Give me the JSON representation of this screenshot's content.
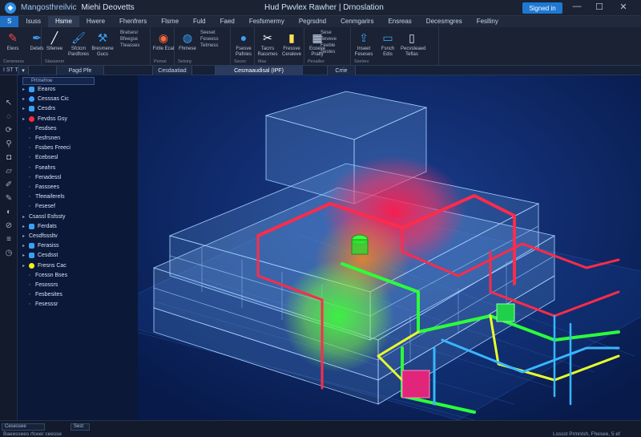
{
  "titlebar": {
    "app_icon": "app-logo-icon",
    "app_name": "Mangosthreilvic",
    "file_name": "Miehi Deovetts",
    "doc_title": "Hud Pwvlex Rawher | Drnoslation",
    "signin_label": "Signed in",
    "minimize": "—",
    "maximize": "☐",
    "close": "✕"
  },
  "menu_tabs": [
    "Isuss",
    "Hsme",
    "Hwere",
    "Fhenfrers",
    "Flsme",
    "Fuld",
    "Faed",
    "Fesfsmermy",
    "Pegrsdnd",
    "Cenmgarirs",
    "Ensreas",
    "Decesmgres",
    "Feslliny"
  ],
  "menu_file": "S",
  "ribbon": {
    "groups": [
      {
        "name": "Cerwrsess",
        "buttons": [
          {
            "icon": "pencil-icon",
            "label": "Elexs"
          },
          {
            "icon": "pen-icon",
            "label": "Detels"
          }
        ]
      },
      {
        "name": "Slaxsenm",
        "buttons": [
          {
            "icon": "line-icon",
            "label": "Stlenee"
          },
          {
            "icon": "brush-icon",
            "label": "Sfctcm Pardfores"
          },
          {
            "icon": "tool-icon",
            "label": "Bresmene Gucs"
          }
        ],
        "mini": [
          "Bratsesr",
          "Bfeegse",
          "Tteasses"
        ]
      },
      {
        "name": "Pemal",
        "buttons": [
          {
            "icon": "palette-icon",
            "label": "Firtle Ecal"
          }
        ]
      },
      {
        "name": "Selsirg",
        "buttons": [
          {
            "icon": "globe-icon",
            "label": "Fhmese"
          }
        ],
        "mini": [
          "Seeset",
          "Feseess",
          "Tetmess"
        ]
      },
      {
        "name": "Ssces",
        "buttons": [
          {
            "icon": "sphere-icon",
            "label": "Fsesve Pafnies"
          }
        ]
      },
      {
        "name": "Mas",
        "buttons": [
          {
            "icon": "scissors-icon",
            "label": "Tacrrs Rassmes"
          },
          {
            "icon": "battery-icon",
            "label": "Fressve Ceraleve"
          }
        ]
      },
      {
        "name": "Pesalles",
        "buttons": [
          {
            "icon": "grid-icon",
            "label": "Ecoeve Pralty"
          }
        ],
        "mini": [
          "Sese",
          "Beveve",
          "Feeble",
          "Sestes"
        ]
      },
      {
        "name": "Sselrev",
        "buttons": [
          {
            "icon": "export-icon",
            "label": "Inseet Feseses"
          },
          {
            "icon": "monitor-icon",
            "label": "Fsnch Edis"
          },
          {
            "icon": "doc-icon",
            "label": "Pecvsteaed Teflas"
          }
        ]
      }
    ]
  },
  "subbar": {
    "left": "I ST T",
    "view_tabs": [
      "Pagd Pfe",
      "Cesdaatiad",
      "Cesmaaudisal (IPF)",
      "Crrie"
    ]
  },
  "tree": {
    "search_placeholder": "Prtmefroe",
    "nodes": [
      {
        "label": "Eearos",
        "level": 0,
        "icon": "cube-icon",
        "color": "#3aa0f5"
      },
      {
        "label": "Cesssas Cic",
        "level": 0,
        "icon": "sphere-icon",
        "color": "#3aa0f5"
      },
      {
        "label": "Cesdrs",
        "level": 0,
        "icon": "cube-icon",
        "color": "#3aa0f5"
      },
      {
        "label": "Fevdss Gsy",
        "level": 0,
        "icon": "red-dot-icon",
        "color": "#ff2b3a"
      },
      {
        "label": "Fesdses",
        "level": 1,
        "icon": "",
        "color": ""
      },
      {
        "label": "Fesfrsnen",
        "level": 1,
        "icon": "",
        "color": ""
      },
      {
        "label": "Fssbes Freeci",
        "level": 1,
        "icon": "",
        "color": ""
      },
      {
        "label": "Ecebsesl",
        "level": 1,
        "icon": "",
        "color": ""
      },
      {
        "label": "Fseahrs",
        "level": 1,
        "icon": "",
        "color": ""
      },
      {
        "label": "Fenadessl",
        "level": 1,
        "icon": "",
        "color": ""
      },
      {
        "label": "Fasssees",
        "level": 1,
        "icon": "",
        "color": ""
      },
      {
        "label": "Tfeeaiferels",
        "level": 1,
        "icon": "",
        "color": ""
      },
      {
        "label": "Fesesef",
        "level": 1,
        "icon": "",
        "color": ""
      },
      {
        "label": "Csassl Esfssty",
        "level": 0,
        "icon": "",
        "color": ""
      },
      {
        "label": "Ferdats",
        "level": 0,
        "icon": "cube-icon",
        "color": "#3aa0f5"
      },
      {
        "label": "Cesdfsssltv",
        "level": 0,
        "icon": "",
        "color": ""
      },
      {
        "label": "Ferasiss",
        "level": 0,
        "icon": "cube-icon",
        "color": "#3aa0f5"
      },
      {
        "label": "Cesdsst",
        "level": 0,
        "icon": "cube-icon",
        "color": "#3aa0f5"
      },
      {
        "label": "Fresns Cac",
        "level": 0,
        "icon": "yellow-dot-icon",
        "color": "#f3f01c"
      },
      {
        "label": "Fcessn Bses",
        "level": 1,
        "icon": "",
        "color": ""
      },
      {
        "label": "Fesossrs",
        "level": 1,
        "icon": "",
        "color": ""
      },
      {
        "label": "Fesbesites",
        "level": 1,
        "icon": "",
        "color": ""
      },
      {
        "label": "Fesesssr",
        "level": 1,
        "icon": "",
        "color": ""
      }
    ]
  },
  "left_tools": [
    "select-icon",
    "lasso-icon",
    "orbit-icon",
    "walk-icon",
    "camera-icon",
    "section-icon",
    "measure-icon",
    "markup-icon",
    "hide-icon",
    "clip-icon",
    "layers-icon",
    "time-icon"
  ],
  "statusbar": {
    "left_text": "Baeessees rfceer ceesse",
    "box1": "Cesessee",
    "box2": "Sest",
    "right_text": "Lsssst Prmnlsh, Fhesee, 5 ef"
  },
  "colors": {
    "accent": "#1f78d1",
    "duct_red": "#ff2b4a",
    "pipe_green": "#2cff3a",
    "pipe_yellow": "#e8ff2a",
    "pipe_blue": "#38b6ff",
    "building": "#7fb6ea"
  }
}
